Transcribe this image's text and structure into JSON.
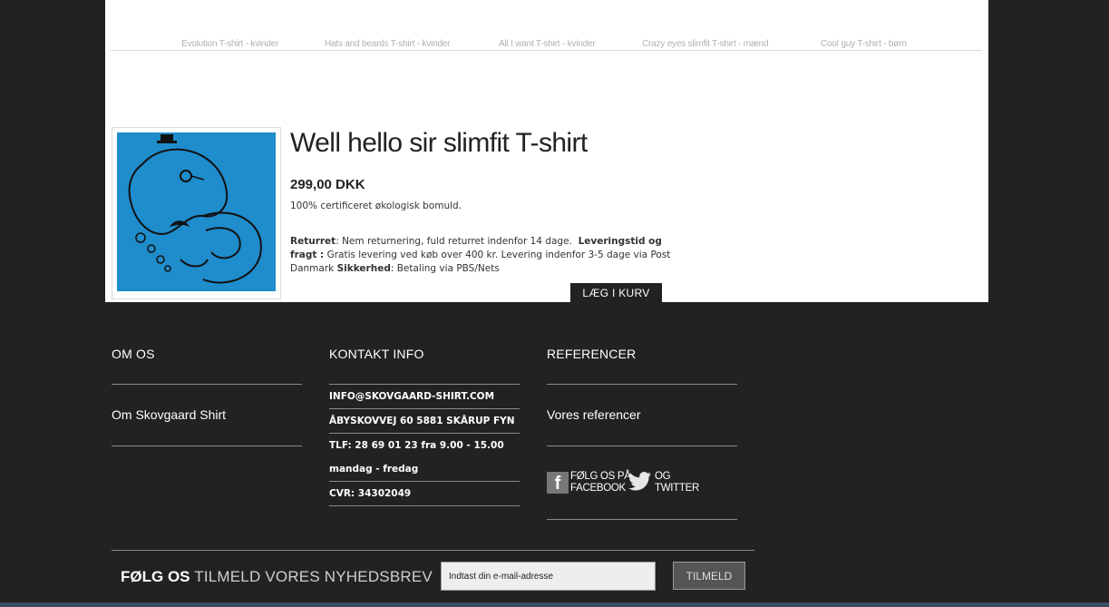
{
  "top_nav": {
    "items": [
      {
        "label": "Evolution T-shirt - kvinder"
      },
      {
        "label": "Hats and beards T-shirt - kvinder"
      },
      {
        "label": "All I want T-shirt - kvinder"
      },
      {
        "label": "Crazy eyes slimfit T-shirt - mænd"
      },
      {
        "label": "Cool guy T-shirt - børn"
      }
    ]
  },
  "product": {
    "title": "Well hello sir slimfit T-shirt",
    "price": "299,00 DKK",
    "description": "100% certificeret økologisk bomuld.",
    "returns_label": "Returret",
    "returns_text": ": Nem returnering, fuld returret indenfor 14 dage.",
    "delivery_label": "Leveringstid og fragt :",
    "delivery_text": " Gratis levering ved køb over 400 kr. Levering indenfor 3-5 dage via Post Danmark ",
    "security_label": "Sikkerhed",
    "security_text": ": Betaling via PBS/Nets",
    "add_to_cart": "LÆG I KURV",
    "image_color": "#1f8ccc"
  },
  "footer": {
    "about": {
      "heading": "OM OS",
      "link": "Om Skovgaard Shirt"
    },
    "contact": {
      "heading": "KONTAKT INFO",
      "rows": [
        "INFO@SKOVGAARD-SHIRT.COM",
        "ÅBYSKOVVEJ 60 5881 SKÅRUP FYN",
        "TLF: 28 69 01 23 fra 9.00 - 15.00",
        "mandag - fredag",
        "CVR: 34302049"
      ]
    },
    "references": {
      "heading": "REFERENCER",
      "link": "Vores referencer",
      "facebook_line1": "FØLG OS PÅ",
      "facebook_line2": "FACEBOOK",
      "twitter_line1": "OG",
      "twitter_line2": "TWITTER",
      "facebook_icon": "facebook-icon",
      "twitter_icon": "twitter-icon"
    }
  },
  "newsletter": {
    "follow_label": "FØLG OS",
    "signup_label": "TILMELD VORES NYHEDSBREV",
    "placeholder": "Indtast din e-mail-adresse",
    "button": "TILMELD"
  }
}
